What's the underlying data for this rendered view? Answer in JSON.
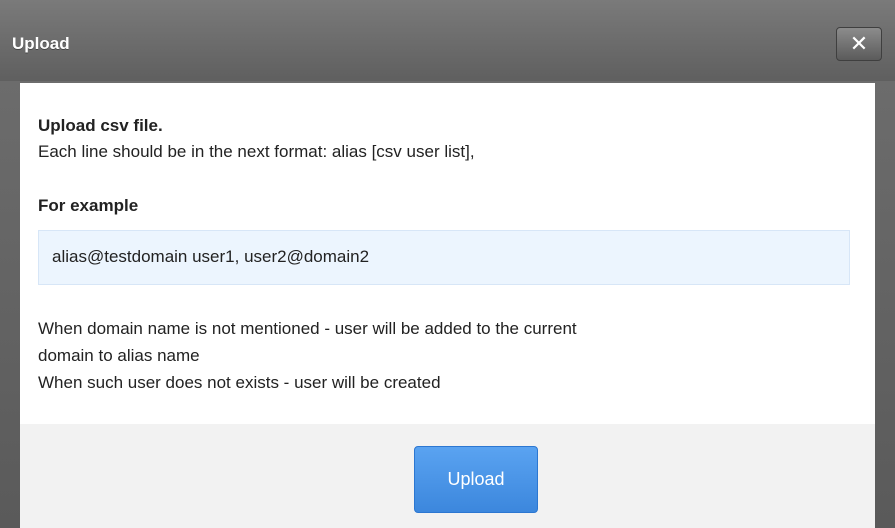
{
  "dialog": {
    "title": "Upload",
    "close_glyph": "✕"
  },
  "content": {
    "heading": "Upload csv file.",
    "format_text": "Each line should be in the next format: alias [csv user list],",
    "example_label": "For example",
    "example_value": "alias@testdomain user1, user2@domain2",
    "note_line1": "When domain name is not mentioned - user will be added to the current",
    "note_line2": "domain to alias name",
    "note_line3": "When such user does not exists - user will be created"
  },
  "footer": {
    "upload_label": "Upload"
  },
  "colors": {
    "titlebar": "#666666",
    "accent_button": "#4a96e8",
    "example_background": "#ecf5fe"
  },
  "icons": {
    "close": "close-icon"
  }
}
